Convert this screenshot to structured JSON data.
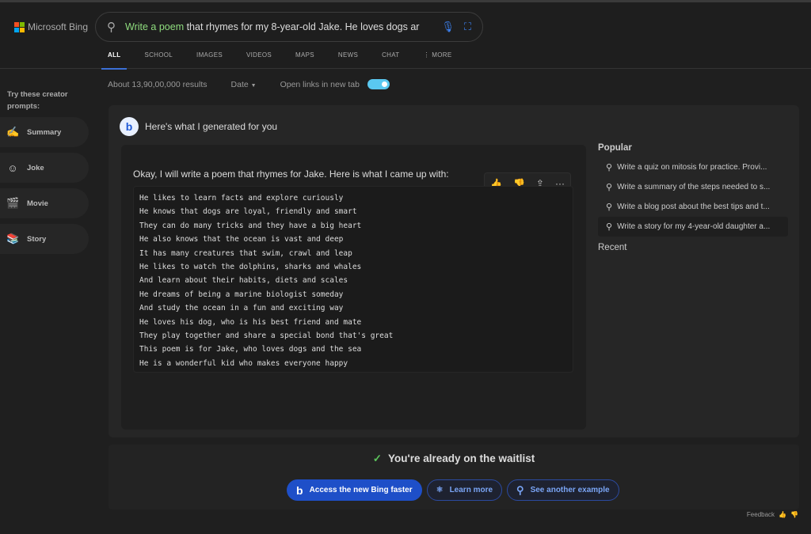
{
  "brand": {
    "name": "Microsoft Bing",
    "logo_colors": [
      "#f25022",
      "#7fba00",
      "#00a4ef",
      "#ffb900"
    ]
  },
  "search": {
    "query_highlight": "Write a poem",
    "query_rest": " that rhymes for my 8-year-old Jake. He loves dogs ar",
    "icons": [
      "search-icon",
      "microphone-icon",
      "visual-search-icon"
    ]
  },
  "tabs": [
    {
      "label": "ALL",
      "active": true
    },
    {
      "label": "SCHOOL"
    },
    {
      "label": "IMAGES"
    },
    {
      "label": "VIDEOS"
    },
    {
      "label": "MAPS"
    },
    {
      "label": "NEWS"
    },
    {
      "label": "CHAT"
    },
    {
      "label": "⋮ MORE"
    }
  ],
  "results": {
    "count": "About 13,90,00,000 results",
    "date_filter": "Date",
    "open_links_label": "Open links in new tab",
    "open_links_on": true
  },
  "sidebar": {
    "title": "Try these creator prompts:",
    "items": [
      {
        "label": "Summary",
        "icon": "✍"
      },
      {
        "label": "Joke",
        "icon": "☺"
      },
      {
        "label": "Movie",
        "icon": "🎬"
      },
      {
        "label": "Story",
        "icon": "📚"
      }
    ]
  },
  "generated": {
    "heading": "Here's what I generated for you",
    "intro": "Okay, I will write a poem that rhymes for Jake. Here is what I came up with:",
    "poem": [
      "He likes to learn facts and explore curiously",
      "He knows that dogs are loyal, friendly and smart",
      "They can do many tricks and they have a big heart",
      "He also knows that the ocean is vast and deep",
      "It has many creatures that swim, crawl and leap",
      "He likes to watch the dolphins, sharks and whales",
      "And learn about their habits, diets and scales",
      "He dreams of being a marine biologist someday",
      "And study the ocean in a fun and exciting way",
      "He loves his dog, who is his best friend and mate",
      "They play together and share a special bond that's great",
      "This poem is for Jake, who loves dogs and the sea",
      "He is a wonderful kid who makes everyone happy"
    ]
  },
  "popular": {
    "title": "Popular",
    "items": [
      "Write a quiz on mitosis for practice. Provi...",
      "Write a summary of the steps needed to s...",
      "Write a blog post about the best tips and t...",
      "Write a story for my 4-year-old daughter a..."
    ],
    "recent_title": "Recent"
  },
  "waitlist": {
    "title": "You're already on the waitlist",
    "access": "Access the new Bing faster",
    "learn": "Learn more",
    "another": "See another example"
  },
  "feedback": {
    "label": "Feedback"
  },
  "colors": {
    "accent": "#1e4fc8",
    "highlight": "#8fdc7e",
    "toggle": "#5ac8f0"
  }
}
